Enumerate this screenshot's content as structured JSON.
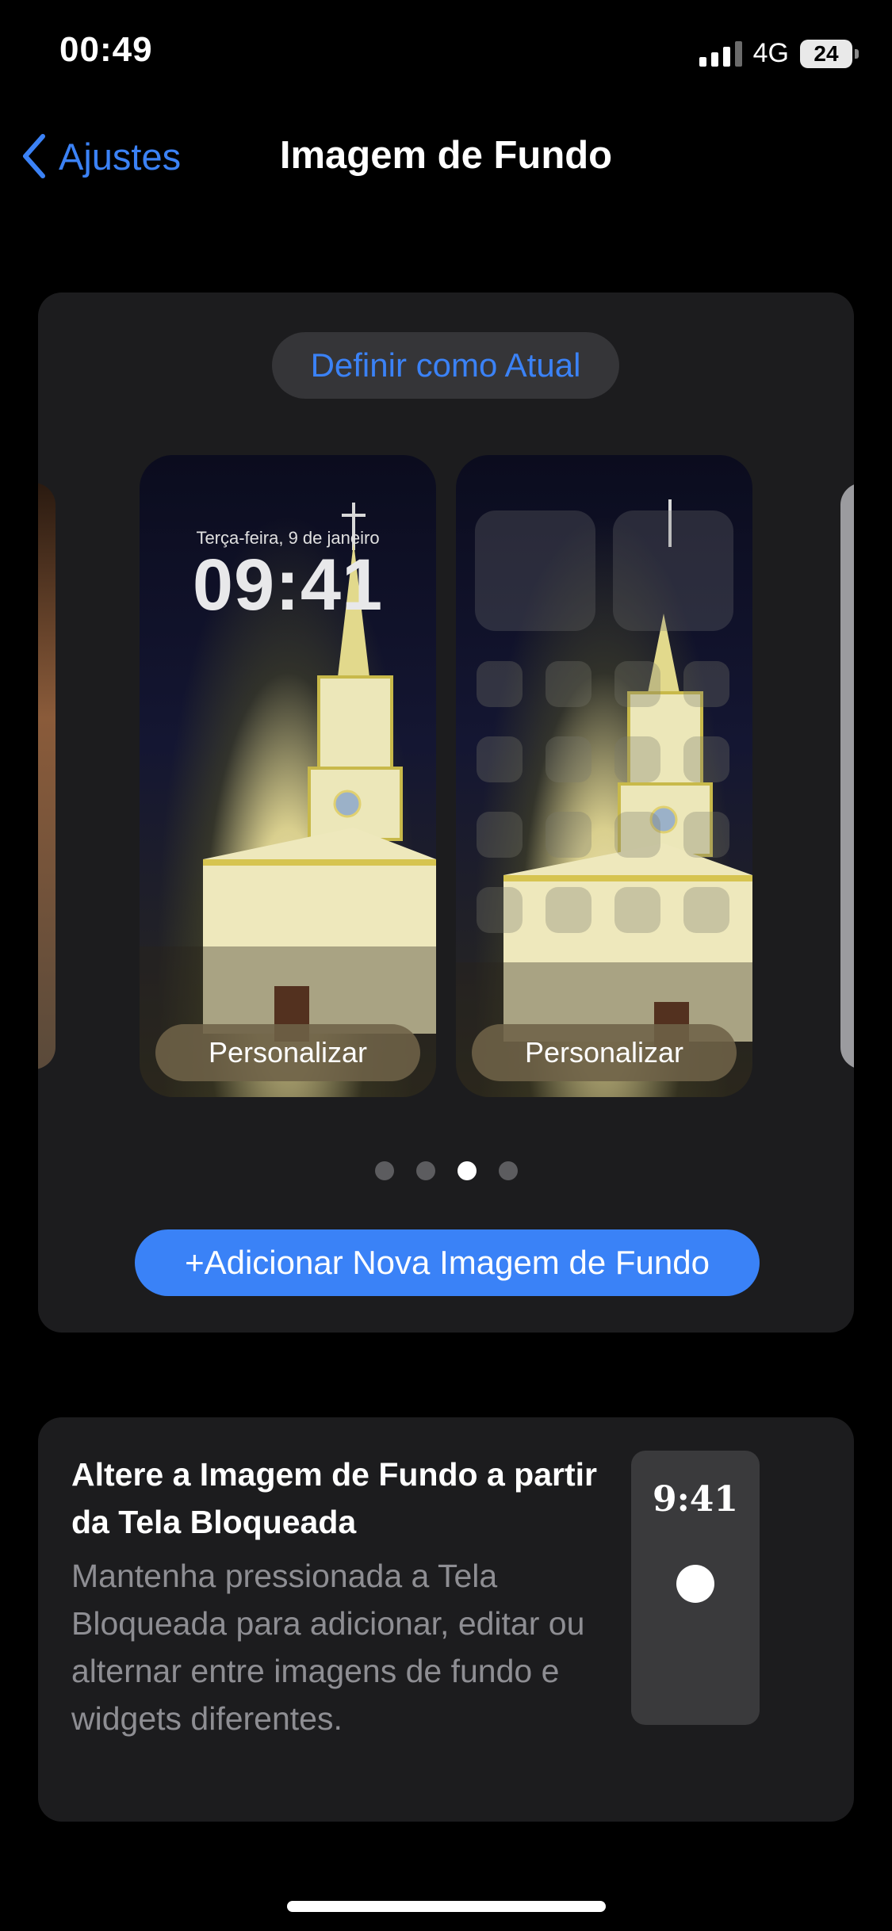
{
  "status_bar": {
    "time": "00:49",
    "network": "4G",
    "battery": "24"
  },
  "nav": {
    "back_label": "Ajustes",
    "title": "Imagem de Fundo"
  },
  "wallpaper_card": {
    "set_current_label": "Definir como Atual",
    "lock_screen": {
      "date": "Terça-feira, 9 de janeiro",
      "time": "09:41",
      "customize_label": "Personalizar"
    },
    "home_screen": {
      "customize_label": "Personalizar"
    },
    "page_indicator": {
      "count": 4,
      "active_index": 3
    },
    "add_label": "+Adicionar Nova Imagem de Fundo"
  },
  "info_card": {
    "title": "Altere a Imagem de Fundo a partir da Tela Bloqueada",
    "body": "Mantenha pressionada a Tela Bloqueada para adicionar, editar ou alternar entre imagens de fundo e widgets diferentes.",
    "mini_time": "9:41"
  },
  "colors": {
    "accent": "#3a82f7",
    "card": "#1c1c1e",
    "background": "#000000"
  }
}
